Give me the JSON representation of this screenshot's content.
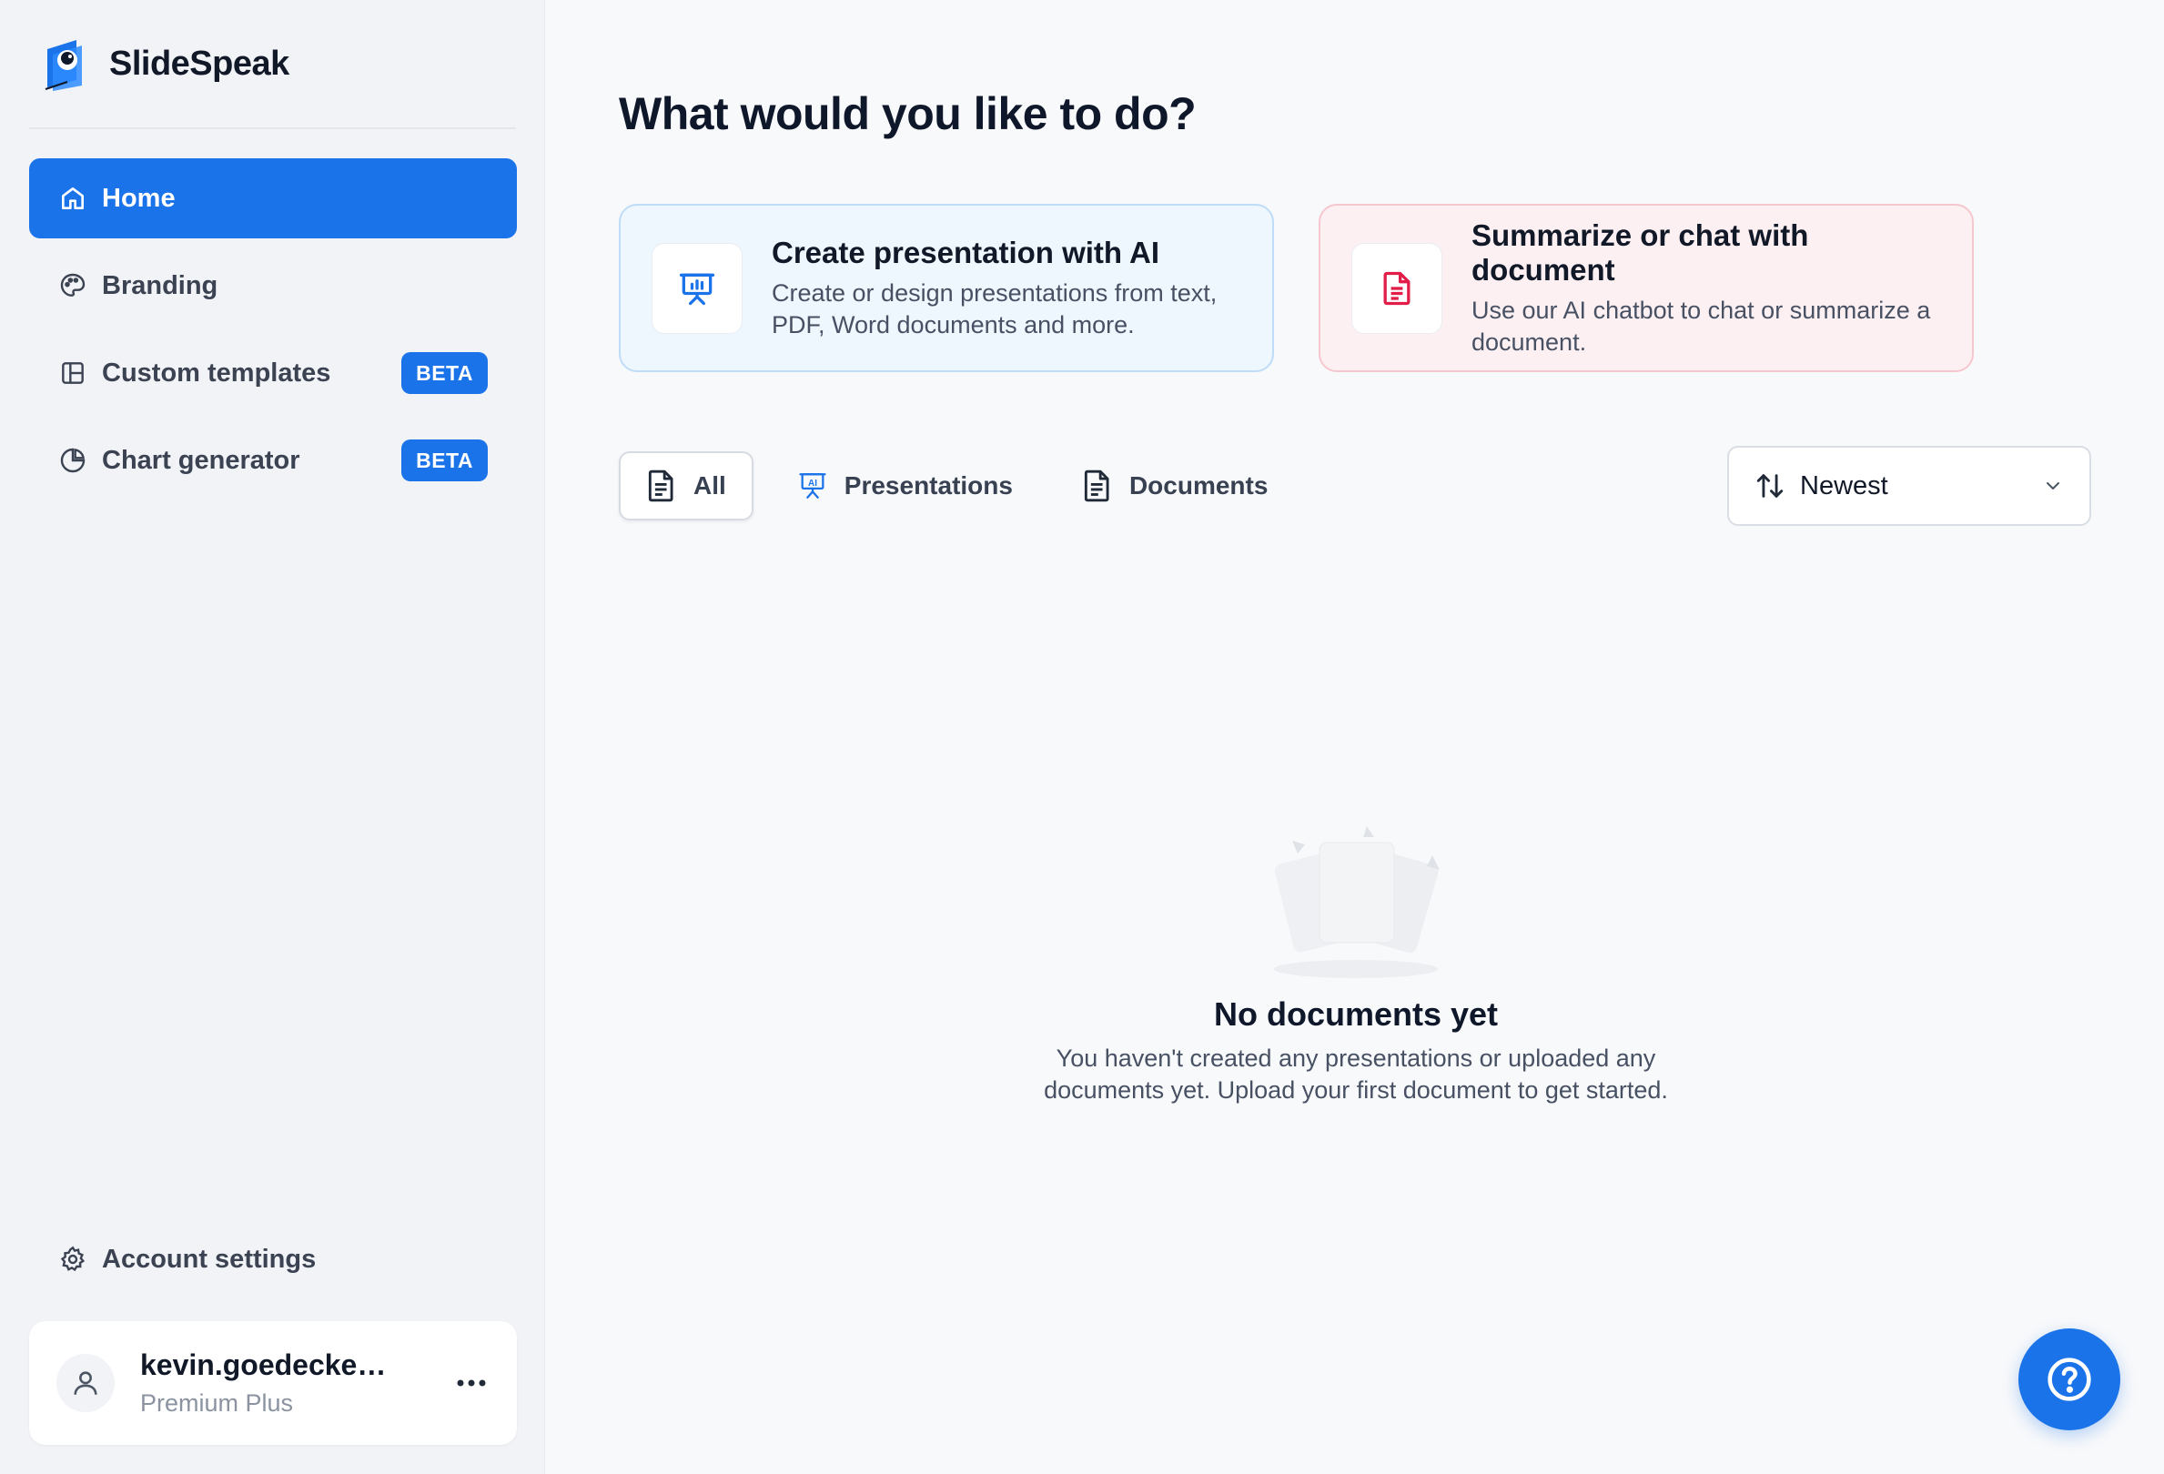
{
  "brand": {
    "name": "SlideSpeak"
  },
  "sidebar": {
    "items": [
      {
        "label": "Home",
        "icon": "home-icon"
      },
      {
        "label": "Branding",
        "icon": "palette-icon"
      },
      {
        "label": "Custom templates",
        "icon": "layout-icon",
        "badge": "BETA"
      },
      {
        "label": "Chart generator",
        "icon": "pie-chart-icon",
        "badge": "BETA"
      }
    ],
    "account_settings": "Account settings"
  },
  "user": {
    "email": "kevin.goedecke@g...",
    "plan": "Premium Plus"
  },
  "main": {
    "title": "What would you like to do?",
    "cards": [
      {
        "title": "Create presentation with AI",
        "description": "Create or design presentations from text, PDF, Word documents and more.",
        "icon": "presentation-icon"
      },
      {
        "title": "Summarize or chat with document",
        "description": "Use our AI chatbot to chat or summarize a document.",
        "icon": "document-icon"
      }
    ],
    "tabs": [
      {
        "label": "All",
        "icon": "document-icon"
      },
      {
        "label": "Presentations",
        "icon": "ai-presentation-icon"
      },
      {
        "label": "Documents",
        "icon": "document-icon"
      }
    ],
    "sort": {
      "selected": "Newest"
    },
    "empty": {
      "title": "No documents yet",
      "text": "You haven't created any presentations or uploaded any documents yet. Upload your first document to get started."
    }
  },
  "colors": {
    "accent": "#1a73e8",
    "badge": "#1a73e8",
    "card_blue_bg": "#eef6fe",
    "card_red_bg": "#fdf0f2",
    "doc_red": "#e11d48"
  }
}
